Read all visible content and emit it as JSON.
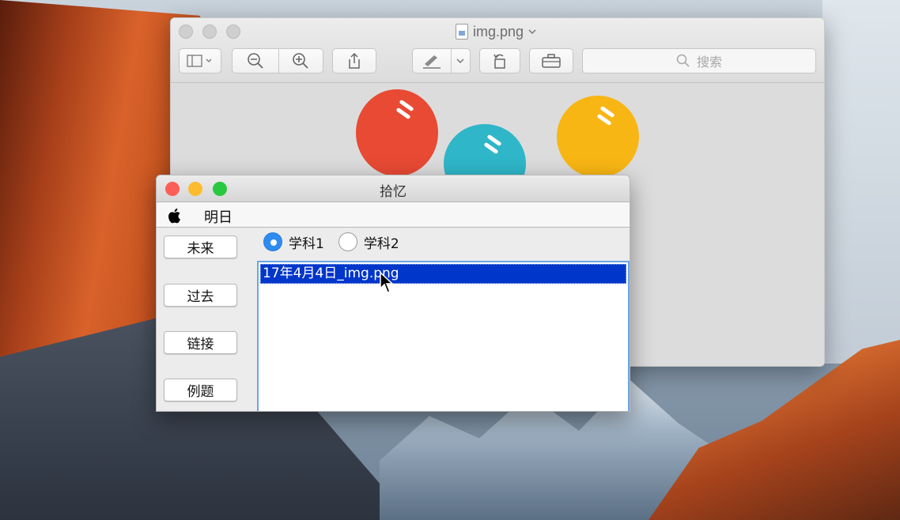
{
  "preview": {
    "title": "img.png",
    "search_placeholder": "搜索",
    "balls": [
      {
        "color": "#e84a34"
      },
      {
        "color": "#2fb6c8"
      },
      {
        "color": "#f8b614"
      }
    ]
  },
  "app": {
    "title": "拾忆",
    "menu": {
      "item": "明日"
    },
    "side_buttons": [
      "未来",
      "过去",
      "链接",
      "例题"
    ],
    "radios": [
      {
        "label": "学科1",
        "checked": true
      },
      {
        "label": "学科2",
        "checked": false
      }
    ],
    "files": [
      "17年4月4日_img.png"
    ]
  },
  "colors": {
    "selection": "#0036c9",
    "radio_accent": "#2e8bf0",
    "close": "#fc5f57",
    "minimize": "#fdbc2e",
    "zoom": "#28c840"
  }
}
